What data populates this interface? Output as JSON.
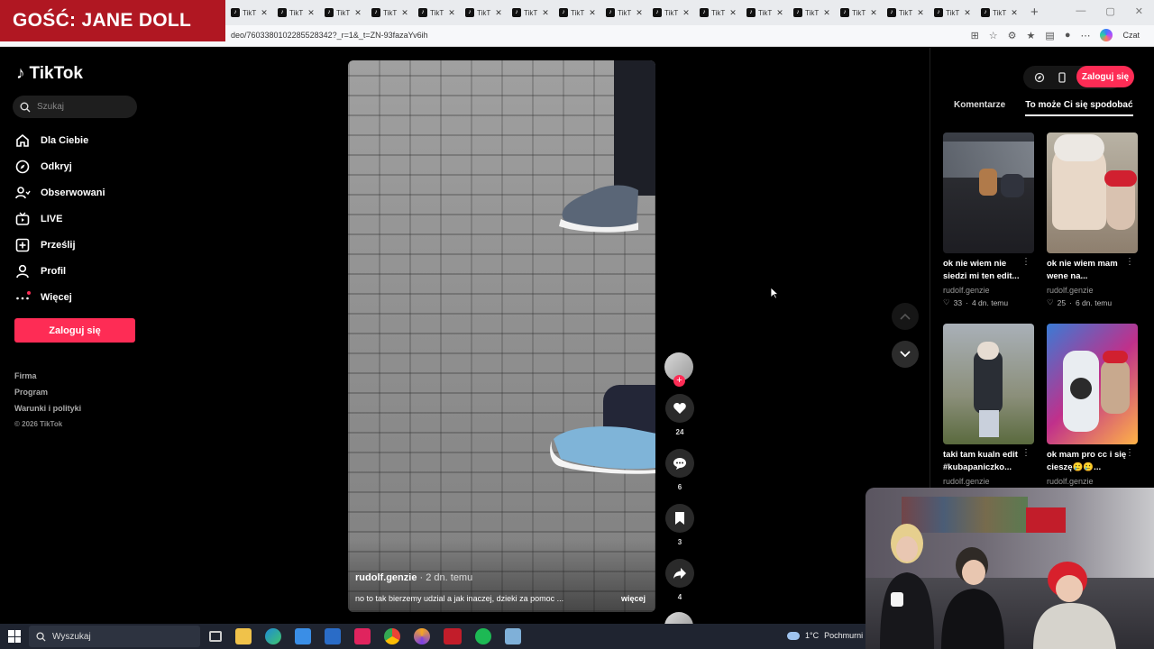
{
  "banner": {
    "text": "GOŚĆ: JANE DOLL"
  },
  "browser": {
    "tab_label": "TikT",
    "tab_count": 17,
    "url": "deo/7603380102285528342?_r=1&_t=ZN-93fazaYv6ih",
    "czat_label": "Czat"
  },
  "sidebar": {
    "logo": "TikTok",
    "search_placeholder": "Szukaj",
    "items": [
      {
        "label": "Dla Ciebie",
        "icon": "home-icon"
      },
      {
        "label": "Odkryj",
        "icon": "compass-icon"
      },
      {
        "label": "Obserwowani",
        "icon": "following-icon"
      },
      {
        "label": "LIVE",
        "icon": "live-icon"
      },
      {
        "label": "Prześlij",
        "icon": "upload-icon"
      },
      {
        "label": "Profil",
        "icon": "profile-icon"
      },
      {
        "label": "Więcej",
        "icon": "more-icon"
      }
    ],
    "login": "Zaloguj się",
    "footer": [
      "Firma",
      "Program",
      "Warunki i polityki"
    ],
    "copyright": "© 2026 TikTok"
  },
  "video": {
    "author": "rudolf.genzie",
    "age": "· 2 dn. temu",
    "caption": "no to tak bierzemy udzial a jak inaczej, dzieki za pomoc ...",
    "more": "więcej"
  },
  "actions": {
    "likes": "24",
    "comments": "6",
    "saves": "3",
    "shares": "4"
  },
  "right_panel": {
    "login": "Zaloguj się",
    "tabs": [
      "Komentarze",
      "To może Ci się spodobać"
    ],
    "cards": [
      {
        "title": "ok nie wiem nie siedzi mi ten edit...",
        "user": "rudolf.genzie",
        "likes": "33",
        "age": "4 dn. temu"
      },
      {
        "title": "ok nie wiem mam wene na...",
        "user": "rudolf.genzie",
        "likes": "25",
        "age": "6 dn. temu"
      },
      {
        "title": "taki tam kualn edit #kubapaniczko...",
        "user": "rudolf.genzie",
        "likes": "",
        "age": ""
      },
      {
        "title": "ok mam pro cc i się cieszę🥲🥲...",
        "user": "rudolf.genzie",
        "likes": "",
        "age": ""
      }
    ]
  },
  "taskbar": {
    "search": "Wyszukaj",
    "weather": "1°C",
    "weather_desc": "Pochmurni"
  },
  "colors": {
    "accent": "#fe2c55",
    "banner": "#b01722"
  }
}
